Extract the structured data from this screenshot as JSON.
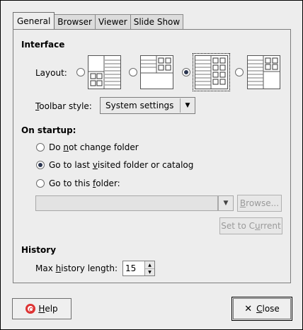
{
  "tabs": [
    "General",
    "Browser",
    "Viewer",
    "Slide Show"
  ],
  "interface": {
    "title": "Interface",
    "layout_label": "Layout:",
    "layout_selected_index": 2,
    "toolbar_label_prefix": "",
    "toolbar_label_mnemonic": "T",
    "toolbar_label_rest": "oolbar style:",
    "toolbar_value": "System settings"
  },
  "startup": {
    "title": "On startup:",
    "options": [
      {
        "before": "Do ",
        "mnemonic": "n",
        "after": "ot change folder",
        "checked": false
      },
      {
        "before": "Go to last ",
        "mnemonic": "v",
        "after": "isited folder or catalog",
        "checked": true
      },
      {
        "before": "Go to this ",
        "mnemonic": "f",
        "after": "older:",
        "checked": false
      }
    ],
    "folder_value": "",
    "browse_before": "",
    "browse_mnemonic": "B",
    "browse_after": "rowse...",
    "set_current_before": "Set to C",
    "set_current_mnemonic": "u",
    "set_current_after": "rrent"
  },
  "history": {
    "title": "History",
    "label_before": "Max ",
    "label_mnemonic": "h",
    "label_after": "istory length:",
    "value": "15"
  },
  "buttons": {
    "help_mnemonic": "H",
    "help_rest": "elp",
    "close_mnemonic": "C",
    "close_rest": "lose"
  }
}
